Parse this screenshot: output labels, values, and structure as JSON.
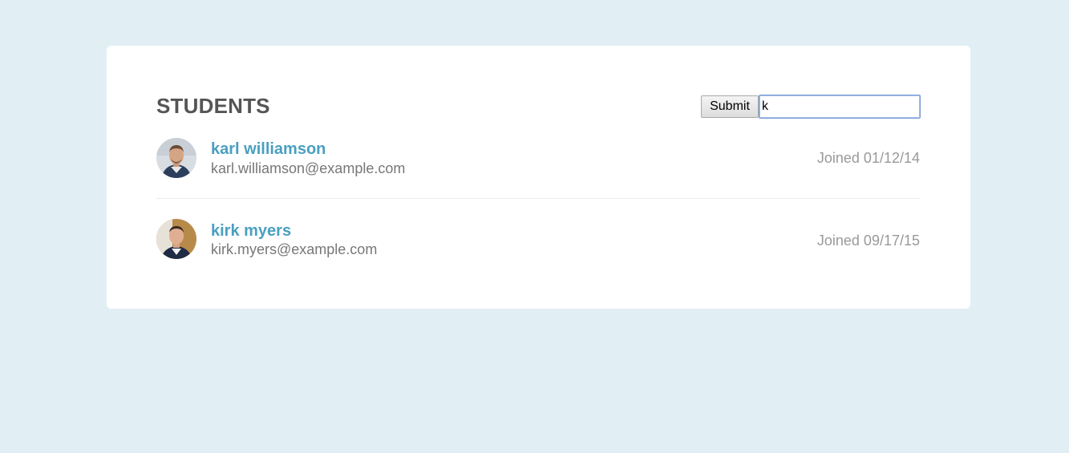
{
  "header": {
    "title": "STUDENTS"
  },
  "search": {
    "submit_label": "Submit",
    "value": "k",
    "placeholder": ""
  },
  "students": [
    {
      "name": "karl williamson",
      "email": "karl.williamson@example.com",
      "joined": "Joined 01/12/14"
    },
    {
      "name": "kirk myers",
      "email": "kirk.myers@example.com",
      "joined": "Joined 09/17/15"
    }
  ],
  "colors": {
    "page_background": "#e1eff5",
    "card_background": "#ffffff",
    "name_link": "#4a9fc0",
    "title_text": "#555555",
    "email_text": "#777777",
    "joined_text": "#999999"
  }
}
